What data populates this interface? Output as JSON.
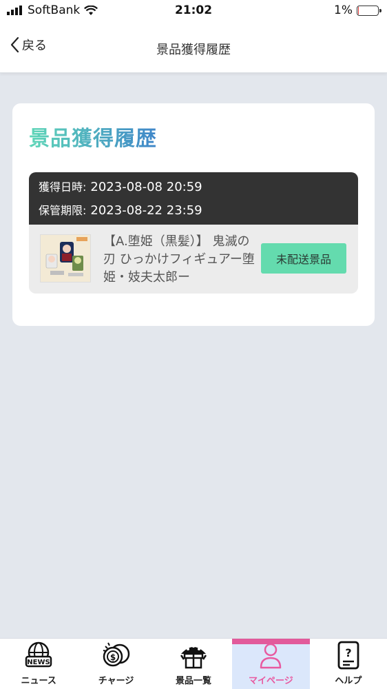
{
  "status_bar": {
    "carrier": "SoftBank",
    "time": "21:02",
    "battery": "1%",
    "battery_level": 0.01
  },
  "nav": {
    "back_label": "戻る",
    "title": "景品獲得履歴"
  },
  "card": {
    "title": "景品獲得履歴",
    "items": [
      {
        "acquired_label": "獲得日時:",
        "acquired_value": "2023-08-08 20:59",
        "storage_label": "保管期限:",
        "storage_value": "2023-08-22 23:59",
        "prize_name": "【A.堕姫（黒髪）】 鬼滅の刃 ひっかけフィギュアー堕姫・妓夫太郎ー",
        "status": "未配送景品"
      }
    ]
  },
  "tabs": [
    {
      "label": "ニュース",
      "icon": "news-globe-icon"
    },
    {
      "label": "チャージ",
      "icon": "coins-icon"
    },
    {
      "label": "景品一覧",
      "icon": "prize-gift-icon"
    },
    {
      "label": "マイページ",
      "icon": "user-icon",
      "active": true
    },
    {
      "label": "ヘルプ",
      "icon": "help-document-icon"
    }
  ],
  "colors": {
    "accent_green": "#64dbae",
    "title_gradient_start": "#5fd6b7",
    "title_gradient_end": "#3f86c9",
    "active_tab_pink": "#e25a9b",
    "active_tab_bg": "#dbe7fb"
  }
}
